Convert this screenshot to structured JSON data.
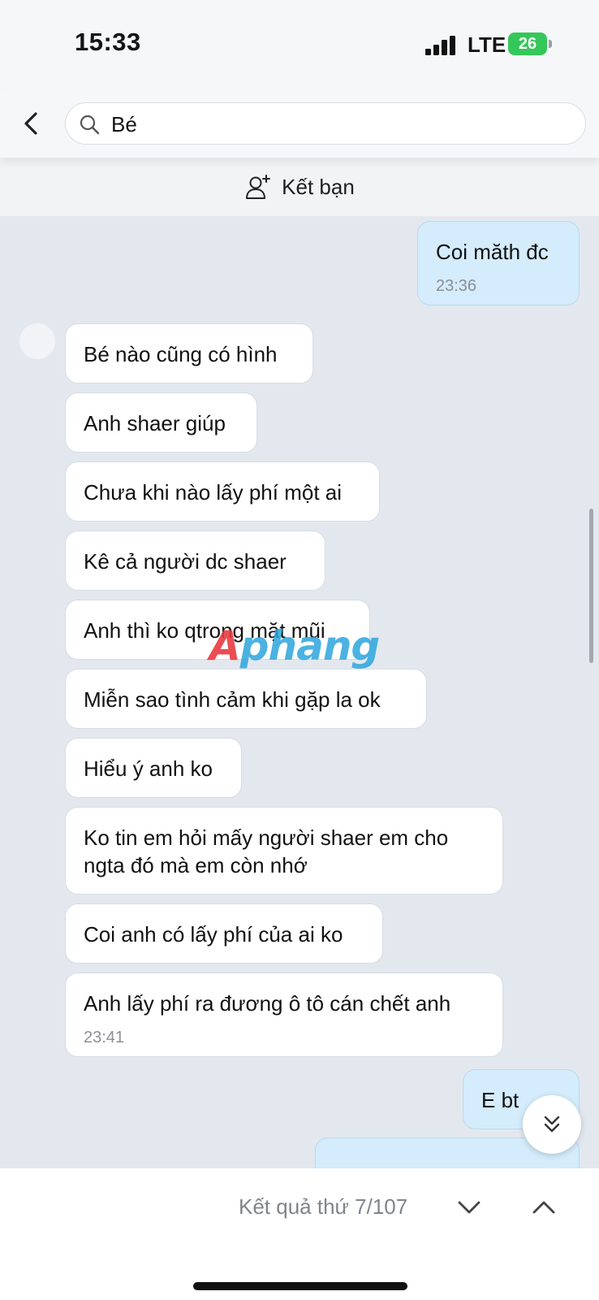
{
  "status_bar": {
    "time": "15:33",
    "network": "LTE",
    "battery": "26",
    "battery_color": "#34c759"
  },
  "header": {
    "search_query": "Bé",
    "back_icon": "chevron-left-icon",
    "search_icon": "search-icon"
  },
  "add_friend": {
    "label": "Kết bạn",
    "icon": "add-person-icon"
  },
  "watermark": {
    "first": "A",
    "rest": "phang"
  },
  "messages": [
    {
      "side": "sent",
      "text": "Coi măth đc",
      "time": "23:36"
    },
    {
      "side": "received",
      "text": "Bé nào cũng có hình"
    },
    {
      "side": "received",
      "text": "Anh shaer giúp"
    },
    {
      "side": "received",
      "text": "Chưa khi nào lấy phí một ai"
    },
    {
      "side": "received",
      "text": "Kê cả người dc shaer"
    },
    {
      "side": "received",
      "text": "Anh thì ko qtrong mặt mũi"
    },
    {
      "side": "received",
      "text": "Miễn sao tình cảm khi gặp la ok"
    },
    {
      "side": "received",
      "text": "Hiểu ý anh ko"
    },
    {
      "side": "received",
      "text_lines": [
        "Ko tin em hỏi mấy người shaer em cho",
        "ngta đó mà em còn nhớ"
      ]
    },
    {
      "side": "received",
      "text": "Coi anh có lấy phí của ai ko"
    },
    {
      "side": "received",
      "text": "Anh lấy phí ra đương ô tô cán chết anh",
      "time": "23:41"
    },
    {
      "side": "sent",
      "text": "E bt"
    },
    {
      "side": "sent",
      "text": ""
    }
  ],
  "scroll_down_icon": "double-chevron-down-icon",
  "search_nav": {
    "result_label": "Kết quả thứ 7/107",
    "next_icon": "chevron-down-icon",
    "prev_icon": "chevron-up-icon"
  },
  "colors": {
    "chat_background": "#e3e8ef",
    "sent_bubble": "#d4ecfb",
    "received_bubble": "#ffffff"
  }
}
